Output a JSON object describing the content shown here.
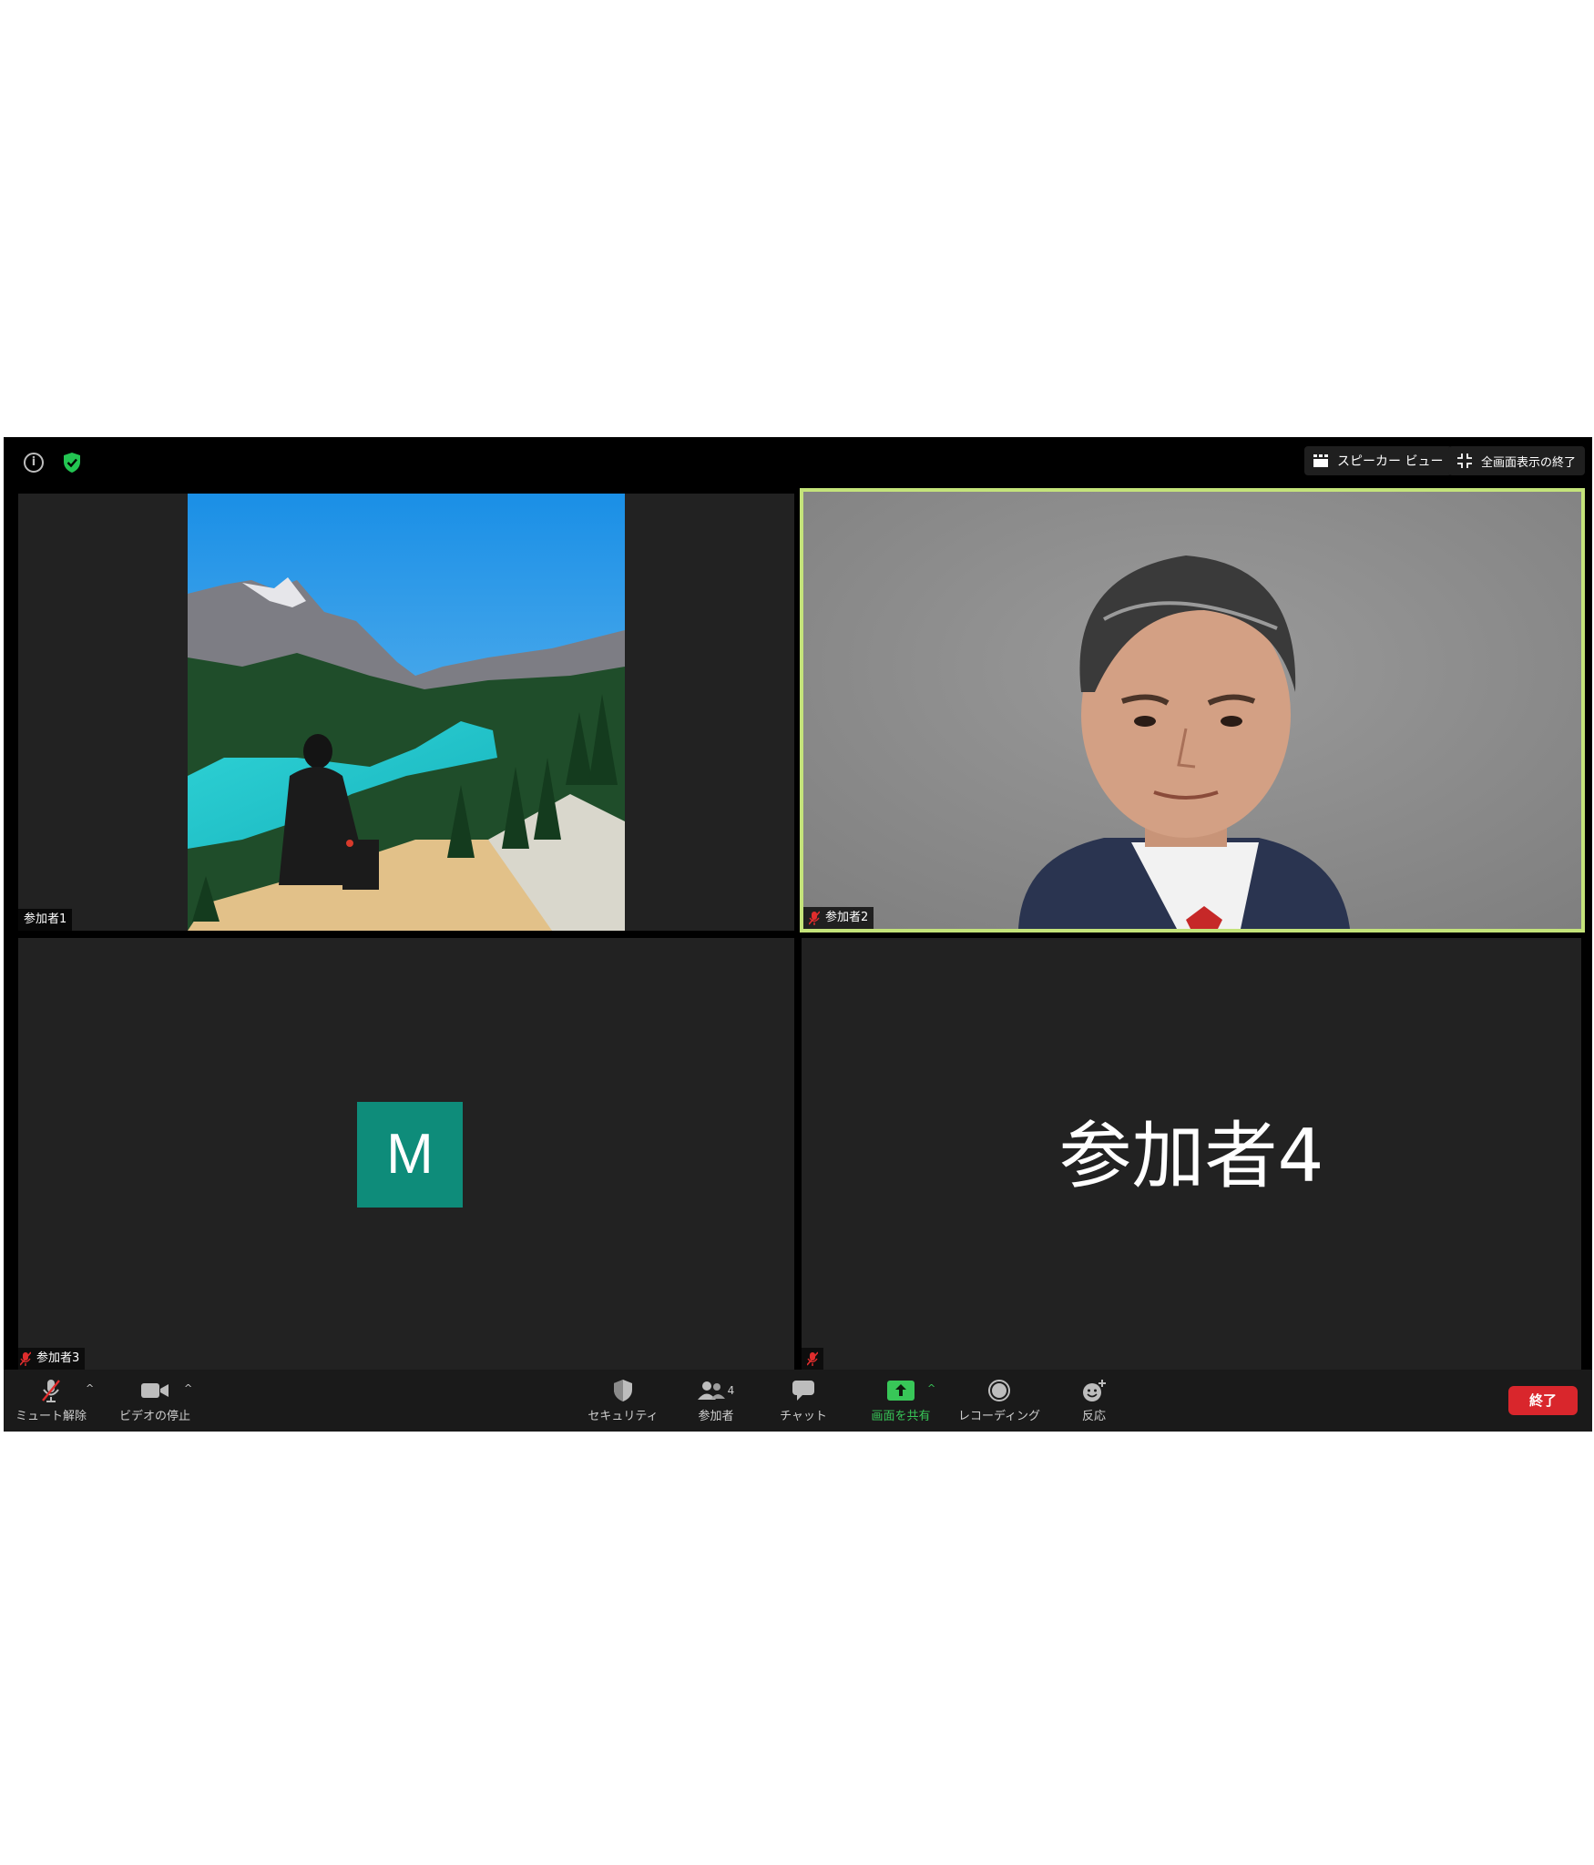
{
  "topbar": {
    "speaker_view_label": "スピーカー ビュー",
    "exit_fullscreen_label": "全画面表示の終了"
  },
  "tiles": [
    {
      "name": "参加者1",
      "muted": false
    },
    {
      "name": "参加者2",
      "muted": true
    },
    {
      "name": "参加者3",
      "muted": true,
      "avatar_initial": "M",
      "avatar_color": "#0e8c7a"
    },
    {
      "name": "参加者4",
      "muted": true
    }
  ],
  "toolbar": {
    "unmute_label": "ミュート解除",
    "stop_video_label": "ビデオの停止",
    "security_label": "セキュリティ",
    "participants_label": "参加者",
    "participants_count": "4",
    "chat_label": "チャット",
    "share_screen_label": "画面を共有",
    "recording_label": "レコーディング",
    "reactions_label": "反応",
    "end_label": "終了"
  },
  "colors": {
    "active_speaker_border": "#c4e37a",
    "share_green": "#38c758",
    "end_red": "#d9262c"
  }
}
